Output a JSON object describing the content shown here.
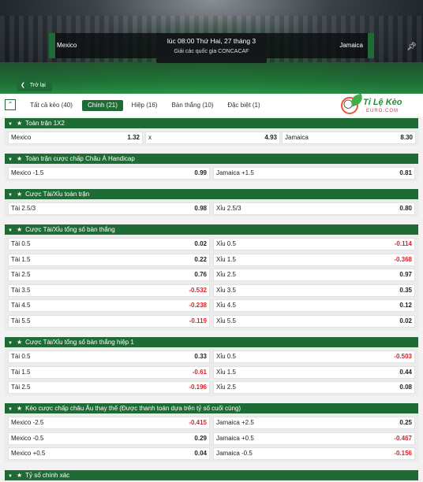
{
  "match": {
    "home": "Mexico",
    "away": "Jamaica",
    "time": "lúc 08:00 Thứ Hai, 27 tháng 3",
    "league": "Giải các quốc gia CONCACAF"
  },
  "nav": {
    "back_label": "Trở lại"
  },
  "tabs": [
    {
      "label": "Tất cả kèo (40)"
    },
    {
      "label": "Chính (21)"
    },
    {
      "label": "Hiệp (16)"
    },
    {
      "label": "Bàn thắng (10)"
    },
    {
      "label": "Đặc biệt (1)"
    }
  ],
  "logo": {
    "brand": "Tỉ Lệ Kèo",
    "sub": "EURO.COM"
  },
  "sections": {
    "s1x2": {
      "title": "Toàn trận 1X2",
      "row": [
        {
          "label": "Mexico",
          "value": "1.32"
        },
        {
          "label": "x",
          "value": "4.93"
        },
        {
          "label": "Jamaica",
          "value": "8.30"
        }
      ]
    },
    "handicap": {
      "title": "Toàn trận cược chấp Châu Á Handicap",
      "rows": [
        [
          {
            "label": "Mexico -1.5",
            "value": "0.99"
          },
          {
            "label": "Jamaica +1.5",
            "value": "0.81"
          }
        ]
      ]
    },
    "ou": {
      "title": "Cược Tài/Xỉu toàn trận",
      "rows": [
        [
          {
            "label": "Tài 2.5/3",
            "value": "0.98"
          },
          {
            "label": "Xỉu 2.5/3",
            "value": "0.80"
          }
        ]
      ]
    },
    "goals": {
      "title": "Cược Tài/Xỉu tổng số bàn thắng",
      "rows": [
        [
          {
            "label": "Tài 0.5",
            "value": "0.02"
          },
          {
            "label": "Xỉu 0.5",
            "value": "-0.114"
          }
        ],
        [
          {
            "label": "Tài 1.5",
            "value": "0.22"
          },
          {
            "label": "Xỉu 1.5",
            "value": "-0.368"
          }
        ],
        [
          {
            "label": "Tài 2.5",
            "value": "0.76"
          },
          {
            "label": "Xỉu 2.5",
            "value": "0.97"
          }
        ],
        [
          {
            "label": "Tài 3.5",
            "value": "-0.532"
          },
          {
            "label": "Xỉu 3.5",
            "value": "0.35"
          }
        ],
        [
          {
            "label": "Tài 4.5",
            "value": "-0.238"
          },
          {
            "label": "Xỉu 4.5",
            "value": "0.12"
          }
        ],
        [
          {
            "label": "Tài 5.5",
            "value": "-0.119"
          },
          {
            "label": "Xỉu 5.5",
            "value": "0.02"
          }
        ]
      ]
    },
    "goals_h1": {
      "title": "Cược Tài/Xỉu tổng số bàn thắng hiệp 1",
      "rows": [
        [
          {
            "label": "Tài 0.5",
            "value": "0.33"
          },
          {
            "label": "Xỉu 0.5",
            "value": "-0.503"
          }
        ],
        [
          {
            "label": "Tài 1.5",
            "value": "-0.61"
          },
          {
            "label": "Xỉu 1.5",
            "value": "0.44"
          }
        ],
        [
          {
            "label": "Tài 2.5",
            "value": "-0.196"
          },
          {
            "label": "Xỉu 2.5",
            "value": "0.08"
          }
        ]
      ]
    },
    "eu_handicap": {
      "title": "Kèo cược chấp châu Âu thay thế (Được thanh toán dựa trên tỷ số cuối cùng)",
      "rows": [
        [
          {
            "label": "Mexico -2.5",
            "value": "-0.415"
          },
          {
            "label": "Jamaica +2.5",
            "value": "0.25"
          }
        ],
        [
          {
            "label": "Mexico -0.5",
            "value": "0.29"
          },
          {
            "label": "Jamaica +0.5",
            "value": "-0.467"
          }
        ],
        [
          {
            "label": "Mexico +0.5",
            "value": "0.04"
          },
          {
            "label": "Jamaica -0.5",
            "value": "-0.156"
          }
        ]
      ]
    },
    "exact": {
      "title": "Tỷ số chính xác"
    }
  },
  "colors": {
    "brand_green": "#1f6b35",
    "negative": "#e0202a"
  },
  "icons": {
    "collapse": "double-chevron-up-icon",
    "star": "star-icon",
    "caret": "caret-down-icon",
    "pin": "pin-icon",
    "back": "chevron-left-icon"
  }
}
